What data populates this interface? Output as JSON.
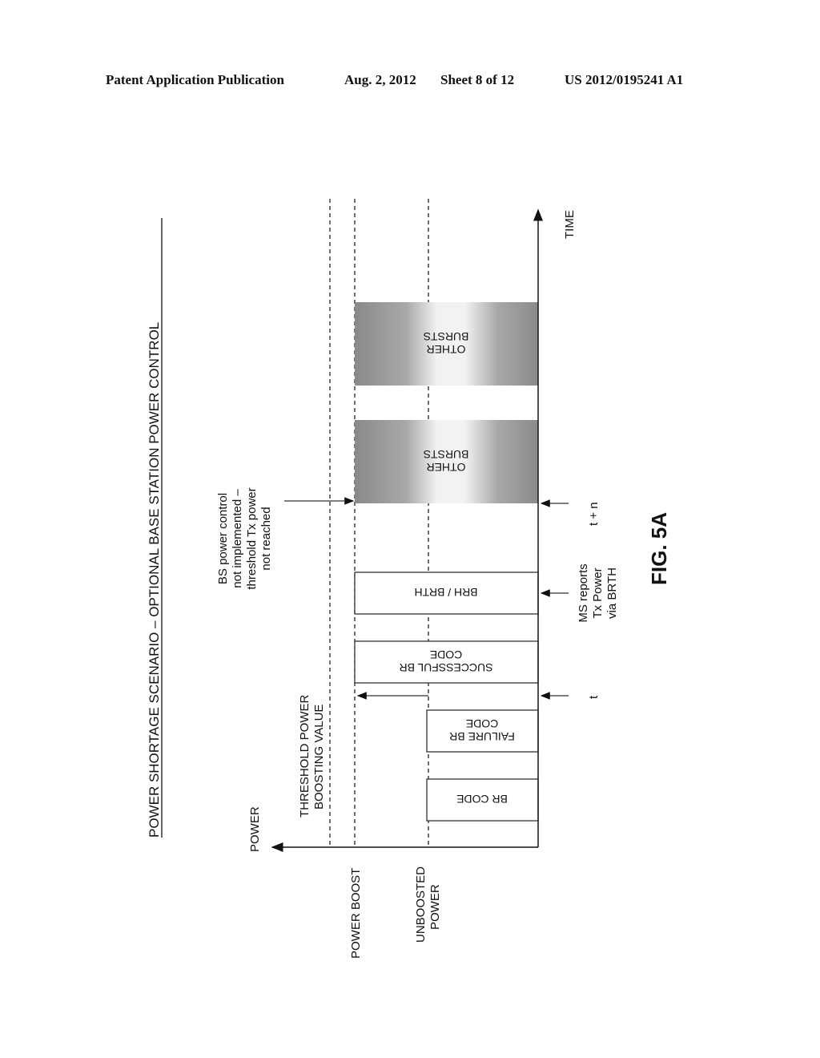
{
  "header": {
    "publication": "Patent Application Publication",
    "date": "Aug. 2, 2012",
    "sheet": "Sheet 8 of 12",
    "number": "US 2012/0195241 A1"
  },
  "figure": {
    "title": "POWER SHORTAGE SCENARIO – OPTIONAL BASE STATION POWER CONTROL",
    "label": "FIG. 5A",
    "axes": {
      "power": "POWER",
      "time": "TIME"
    },
    "levels": {
      "threshold": [
        "THRESHOLD POWER",
        "BOOSTING VALUE"
      ],
      "power_boost": "POWER BOOST",
      "unboosted": [
        "UNBOOSTED",
        "POWER"
      ]
    },
    "bursts": {
      "br_code": [
        "BR CODE"
      ],
      "failure_br_code": [
        "FAILURE BR",
        "CODE"
      ],
      "successful_br_code": [
        "SUCCESSFUL BR",
        "CODE"
      ],
      "brh_brth": [
        "BRH / BRTH"
      ],
      "other_bursts_1": [
        "OTHER",
        "BURSTS"
      ],
      "other_bursts_2": [
        "OTHER",
        "BURSTS"
      ]
    },
    "annotations": {
      "bs_note": [
        "BS power control",
        "not implemented –",
        "threshold Tx power",
        "not reached"
      ],
      "t": "t",
      "ms_reports": [
        "MS reports",
        "Tx Power",
        "via BRTH"
      ],
      "t_plus_n": "t + n"
    }
  }
}
